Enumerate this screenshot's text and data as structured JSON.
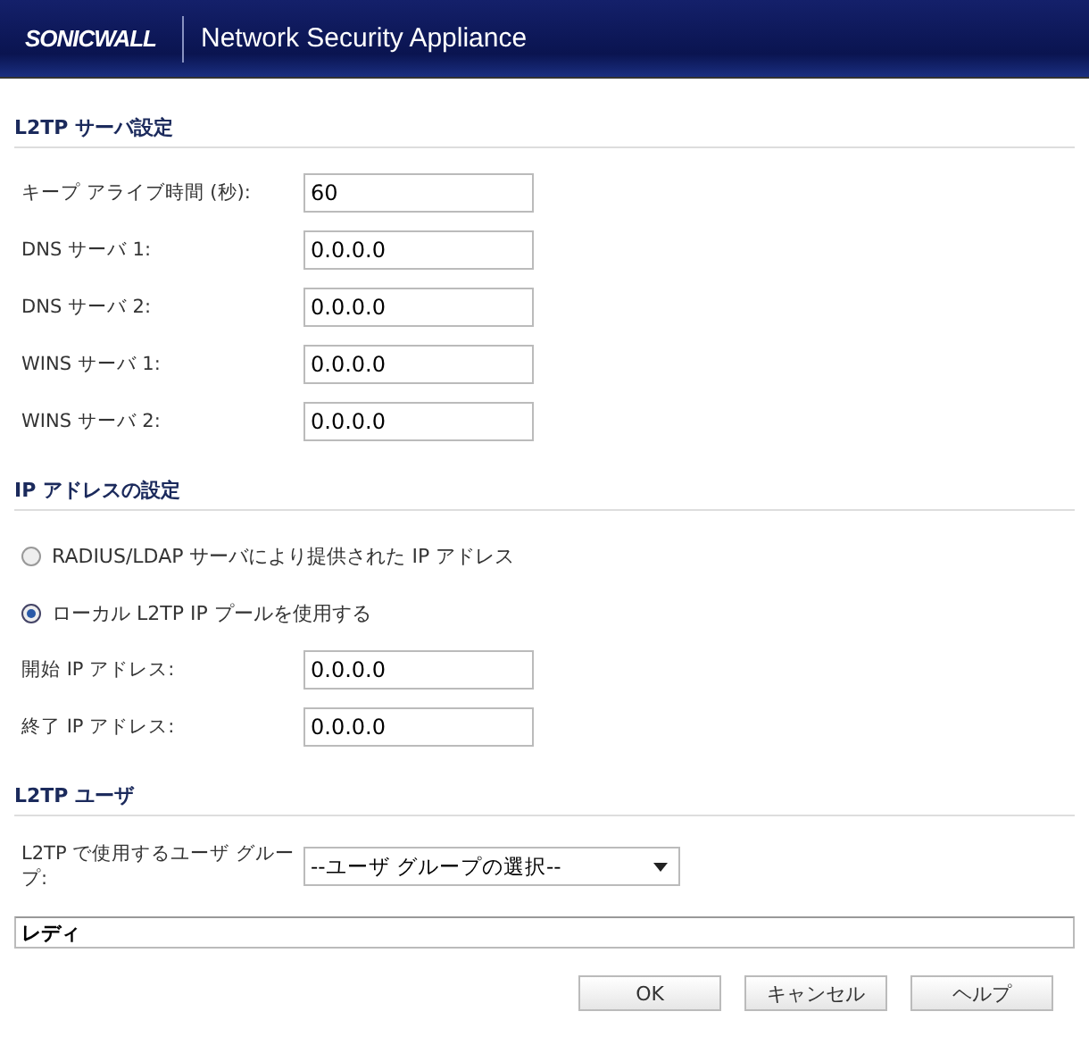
{
  "header": {
    "logo": "SONICWALL",
    "title": "Network Security Appliance"
  },
  "sections": [
    {
      "title": "L2TP サーバ設定",
      "rows": [
        {
          "kind": "field",
          "label": "キープ アライブ時間 (秒):",
          "value": "60"
        },
        {
          "kind": "field",
          "label": "DNS サーバ 1:",
          "value": "0.0.0.0"
        },
        {
          "kind": "field",
          "label": "DNS サーバ 2:",
          "value": "0.0.0.0"
        },
        {
          "kind": "field",
          "label": "WINS サーバ 1:",
          "value": "0.0.0.0"
        },
        {
          "kind": "field",
          "label": "WINS サーバ 2:",
          "value": "0.0.0.0"
        }
      ]
    },
    {
      "title": "IP アドレスの設定",
      "rows": [
        {
          "kind": "radio",
          "label": "RADIUS/LDAP サーバにより提供された IP アドレス",
          "selected": false
        },
        {
          "kind": "radio",
          "label": "ローカル L2TP IP プールを使用する",
          "selected": true
        },
        {
          "kind": "field",
          "label": "開始 IP アドレス:",
          "value": "0.0.0.0"
        },
        {
          "kind": "field",
          "label": "終了 IP アドレス:",
          "value": "0.0.0.0"
        }
      ]
    },
    {
      "title": "L2TP ユーザ",
      "rows": [
        {
          "kind": "select",
          "label": "L2TP で使用するユーザ グループ:",
          "value": "--ユーザ グループの選択--"
        }
      ]
    }
  ],
  "status_bar": "レディ",
  "buttons": [
    "OK",
    "キャンセル",
    "ヘルプ"
  ]
}
